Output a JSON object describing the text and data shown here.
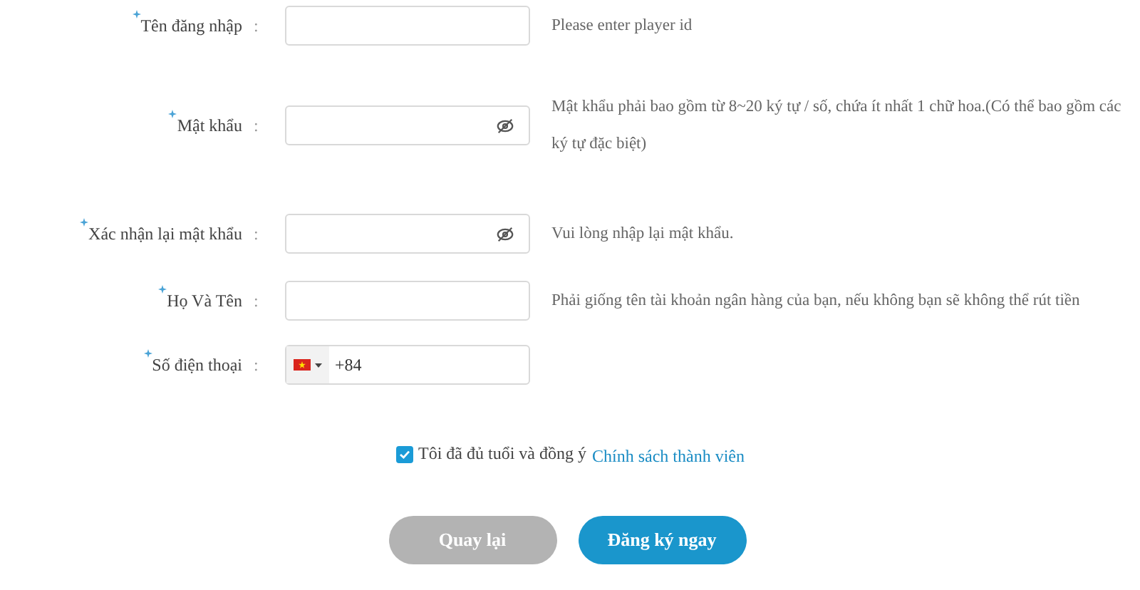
{
  "fields": [
    {
      "kind": "text",
      "label": "Tên đăng nhập",
      "colon": ":",
      "required": true,
      "hint": "Please enter player id"
    },
    {
      "kind": "password",
      "label": "Mật khẩu",
      "colon": ":",
      "required": true,
      "hint": "Mật khẩu phải bao gồm từ 8~20 ký tự / số, chứa ít nhất 1 chữ hoa.(Có thể bao gồm các ký tự đặc biệt)"
    },
    {
      "kind": "password",
      "label": "Xác nhận lại mật khẩu",
      "colon": ":",
      "required": true,
      "hint": "Vui lòng nhập lại mật khẩu."
    },
    {
      "kind": "text",
      "label": "Họ Và Tên",
      "colon": ":",
      "required": true,
      "hint": "Phải giống tên tài khoản ngân hàng của bạn, nếu không bạn sẽ không thể rút tiền"
    },
    {
      "kind": "phone",
      "label": "Số điện thoại",
      "colon": ":",
      "required": true,
      "value": "+84"
    }
  ],
  "agreement": {
    "checked": true,
    "text": "Tôi đã đủ tuổi và đồng ý",
    "link": "Chính sách thành viên"
  },
  "buttons": [
    {
      "kind": "secondary",
      "label": "Quay lại"
    },
    {
      "kind": "primary",
      "label": "Đăng ký ngay"
    }
  ]
}
